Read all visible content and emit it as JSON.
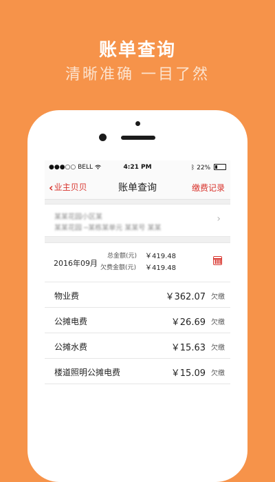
{
  "promo": {
    "headline": "账单查询",
    "subline": "清晰准确 一目了然"
  },
  "statusbar": {
    "signal": "●●●○○ BELL",
    "wifi_icon": "wifi-icon",
    "time": "4:21 PM",
    "battery_percent": "22%",
    "battery_level": 0.22
  },
  "navbar": {
    "back_label": "业主贝贝",
    "title": "账单查询",
    "right_label": "缴费记录"
  },
  "address": {
    "line1": "某某花园小区某",
    "line2": "某某花园 ─某栋某单元 某某号 某某"
  },
  "summary": {
    "month": "2016年09月",
    "total_label": "总金额(元)",
    "total_value": "￥419.48",
    "owed_label": "欠费金额(元)",
    "owed_value": "￥419.48"
  },
  "fees": [
    {
      "name": "物业费",
      "amount": "￥362.07",
      "status": "欠缴"
    },
    {
      "name": "公摊电费",
      "amount": "￥26.69",
      "status": "欠缴"
    },
    {
      "name": "公摊水费",
      "amount": "￥15.63",
      "status": "欠缴"
    },
    {
      "name": "楼道照明公摊电费",
      "amount": "￥15.09",
      "status": "欠缴"
    }
  ],
  "colors": {
    "background": "#F6934A",
    "accent": "#D8322B"
  }
}
